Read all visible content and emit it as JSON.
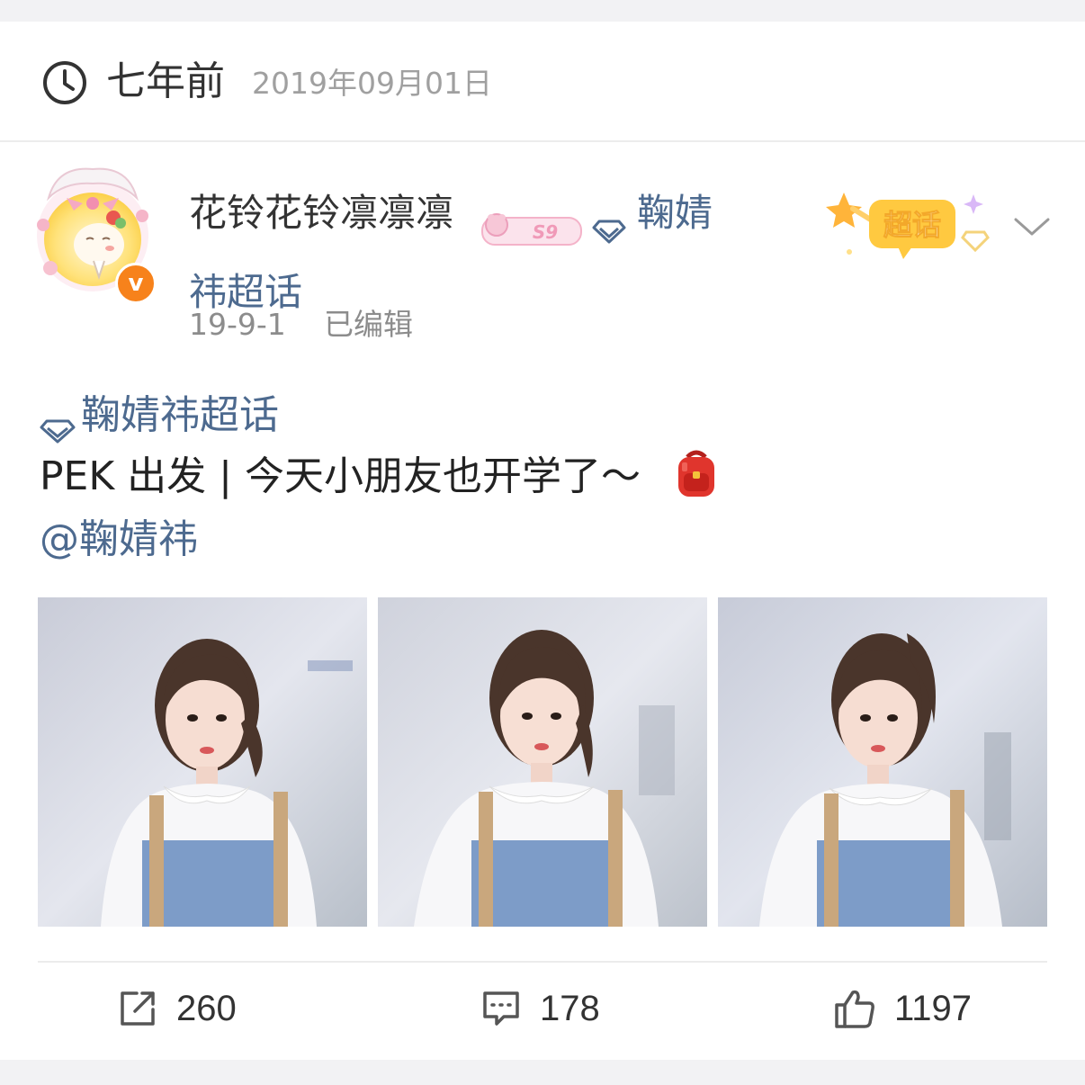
{
  "header": {
    "relative_time": "七年前",
    "absolute_date": "2019年09月01日"
  },
  "post": {
    "username": "花铃花铃凛凛凛",
    "level_badge": "S9",
    "topic_link_part1": "鞠婧",
    "topic_link_part2": "祎超话",
    "date": "19-9-1",
    "edited_label": "已编辑",
    "chaohua_badge": "超话",
    "tag": "鞠婧祎超话",
    "text": "PEK 出发 | 今天小朋友也开学了～",
    "mention": "@鞠婧祎"
  },
  "photos": [
    {
      "name": "photo-1"
    },
    {
      "name": "photo-2"
    },
    {
      "name": "photo-3"
    }
  ],
  "actions": {
    "repost_count": "260",
    "comment_count": "178",
    "like_count": "1197"
  },
  "colors": {
    "link": "#4d6a8f",
    "verified": "#f7821b",
    "badge": "#fbb833"
  }
}
